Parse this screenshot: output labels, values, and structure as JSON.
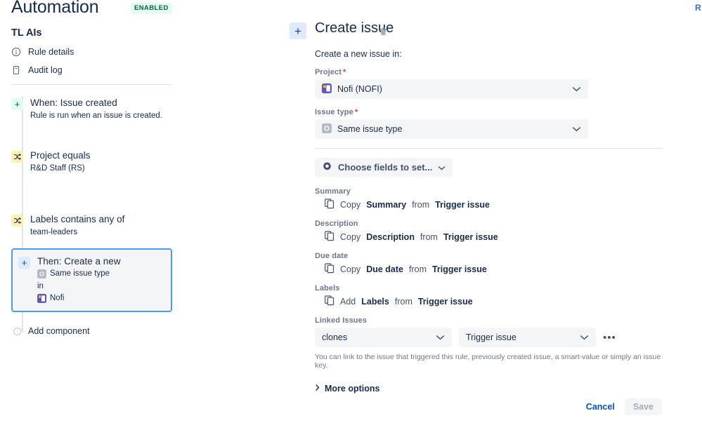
{
  "header": {
    "title": "Automation",
    "status_badge": "ENABLED",
    "corner_link": "R"
  },
  "sidebar": {
    "rule_name": "TL AIs",
    "nav": [
      {
        "label": "Rule details",
        "icon": "info-circle-icon"
      },
      {
        "label": "Audit log",
        "icon": "document-icon"
      }
    ],
    "components": [
      {
        "kind": "trigger",
        "icon": "plus-icon",
        "title": "When: Issue created",
        "subtitle": "Rule is run when an issue is created."
      },
      {
        "kind": "condition",
        "icon": "shuffle-icon",
        "title": "Project equals",
        "subtitle": "R&D Staff (RS)"
      },
      {
        "kind": "condition",
        "icon": "shuffle-icon",
        "title": "Labels contains any of",
        "subtitle": "team-leaders"
      }
    ],
    "selected_component": {
      "kind": "action",
      "icon": "plus-icon",
      "title": "Then: Create a new",
      "issue_type": "Same issue type",
      "connector": "in",
      "project": "Nofi"
    },
    "add_component": "Add component"
  },
  "detail": {
    "title": "Create issue",
    "delete_icon": "trash-icon",
    "add_icon": "plus-icon",
    "intro": "Create a new issue in:",
    "project": {
      "label": "Project",
      "required": "*",
      "value": "Nofi (NOFI)",
      "icon": "project-avatar-icon"
    },
    "issue_type": {
      "label": "Issue type",
      "required": "*",
      "value": "Same issue type",
      "icon": "issue-type-icon"
    },
    "chooser": {
      "label": "Choose fields to set...",
      "icon": "gear-icon"
    },
    "fields": [
      {
        "label": "Summary",
        "action": "Copy",
        "field": "Summary",
        "preposition": "from",
        "source": "Trigger issue",
        "menu": "•••"
      },
      {
        "label": "Description",
        "action": "Copy",
        "field": "Description",
        "preposition": "from",
        "source": "Trigger issue",
        "menu": "•••"
      },
      {
        "label": "Due date",
        "action": "Copy",
        "field": "Due date",
        "preposition": "from",
        "source": "Trigger issue",
        "menu": "•••"
      },
      {
        "label": "Labels",
        "action": "Add",
        "field": "Labels",
        "preposition": "from",
        "source": "Trigger issue",
        "menu": "•••"
      }
    ],
    "linked_issues": {
      "label": "Linked Issues",
      "link_type": "clones",
      "target": "Trigger issue",
      "menu": "•••",
      "help": "You can link to the issue that triggered this rule, previously created issue, a smart-value or simply an issue key."
    },
    "more_options": "More options"
  },
  "footer": {
    "cancel": "Cancel",
    "save": "Save"
  },
  "colors": {
    "accent": "#0052CC",
    "trigger_bg": "#E3FCEF",
    "condition_bg": "#FFF0B3",
    "action_bg": "#DEEBFF",
    "selected_border": "#4C9AFF",
    "badge_text": "#006644",
    "required": "#DE350B"
  }
}
